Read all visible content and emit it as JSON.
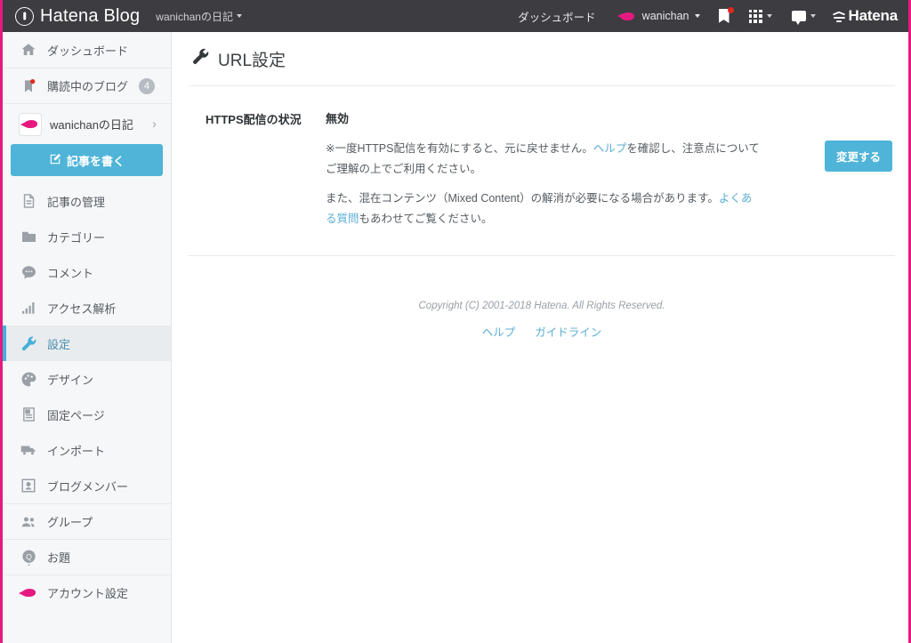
{
  "header": {
    "brand": "Hatena Blog",
    "brand_icon": "hatena-b-icon",
    "blog_selector": "wanichanの日記",
    "dashboard_link": "ダッシュボード",
    "user_name": "wanichan",
    "bookmark_icon": "bookmark-icon",
    "apps_icon": "apps-grid-icon",
    "notifications_icon": "speech-bubble-icon",
    "hatena_logo": "Hatena",
    "bg_color": "#3c3c41",
    "accent_pink": "#e5197f"
  },
  "sidebar": {
    "items": [
      {
        "label": "ダッシュボード",
        "icon": "home-icon",
        "active": false,
        "badge": null
      },
      {
        "label": "購読中のブログ",
        "icon": "bookmark-icon",
        "active": false,
        "badge": "4"
      },
      {
        "label": "記事の管理",
        "icon": "document-icon",
        "active": false,
        "badge": null
      },
      {
        "label": "カテゴリー",
        "icon": "folder-icon",
        "active": false,
        "badge": null
      },
      {
        "label": "コメント",
        "icon": "comment-icon",
        "active": false,
        "badge": null
      },
      {
        "label": "アクセス解析",
        "icon": "bar-chart-icon",
        "active": false,
        "badge": null
      },
      {
        "label": "設定",
        "icon": "wrench-icon",
        "active": true,
        "badge": null
      },
      {
        "label": "デザイン",
        "icon": "palette-icon",
        "active": false,
        "badge": null
      },
      {
        "label": "固定ページ",
        "icon": "page-icon",
        "active": false,
        "badge": null
      },
      {
        "label": "インポート",
        "icon": "truck-icon",
        "active": false,
        "badge": null
      },
      {
        "label": "ブログメンバー",
        "icon": "member-card-icon",
        "active": false,
        "badge": null
      },
      {
        "label": "グループ",
        "icon": "people-icon",
        "active": false,
        "badge": null
      },
      {
        "label": "お題",
        "icon": "question-badge-icon",
        "active": false,
        "badge": null
      },
      {
        "label": "アカウント設定",
        "icon": "fish-avatar-icon",
        "active": false,
        "badge": null
      }
    ],
    "blog_row": {
      "label": "wanichanの日記",
      "avatar_icon": "fish-avatar-icon",
      "chevron_icon": "chevron-right-icon"
    },
    "write_button": {
      "label": "記事を書く",
      "icon": "pencil-square-icon",
      "color": "#4fb4d8"
    }
  },
  "main": {
    "page_title": "URL設定",
    "page_title_icon": "wrench-icon",
    "section": {
      "field_label": "HTTPS配信の状況",
      "status_value": "無効",
      "note1_pre": "※一度HTTPS配信を有効にすると、元に戻せません。",
      "note1_link": "ヘルプ",
      "note1_post": "を確認し、注意点についてご理解の上でご利用ください。",
      "note2_pre": "また、混在コンテンツ（Mixed Content）の解消が必要になる場合があります。",
      "note2_link": "よくある質問",
      "note2_post": "もあわせてご覧ください。",
      "change_button": "変更する"
    }
  },
  "footer": {
    "copyright": "Copyright (C) 2001-2018 Hatena. All Rights Reserved.",
    "links": [
      {
        "label": "ヘルプ"
      },
      {
        "label": "ガイドライン"
      }
    ]
  }
}
